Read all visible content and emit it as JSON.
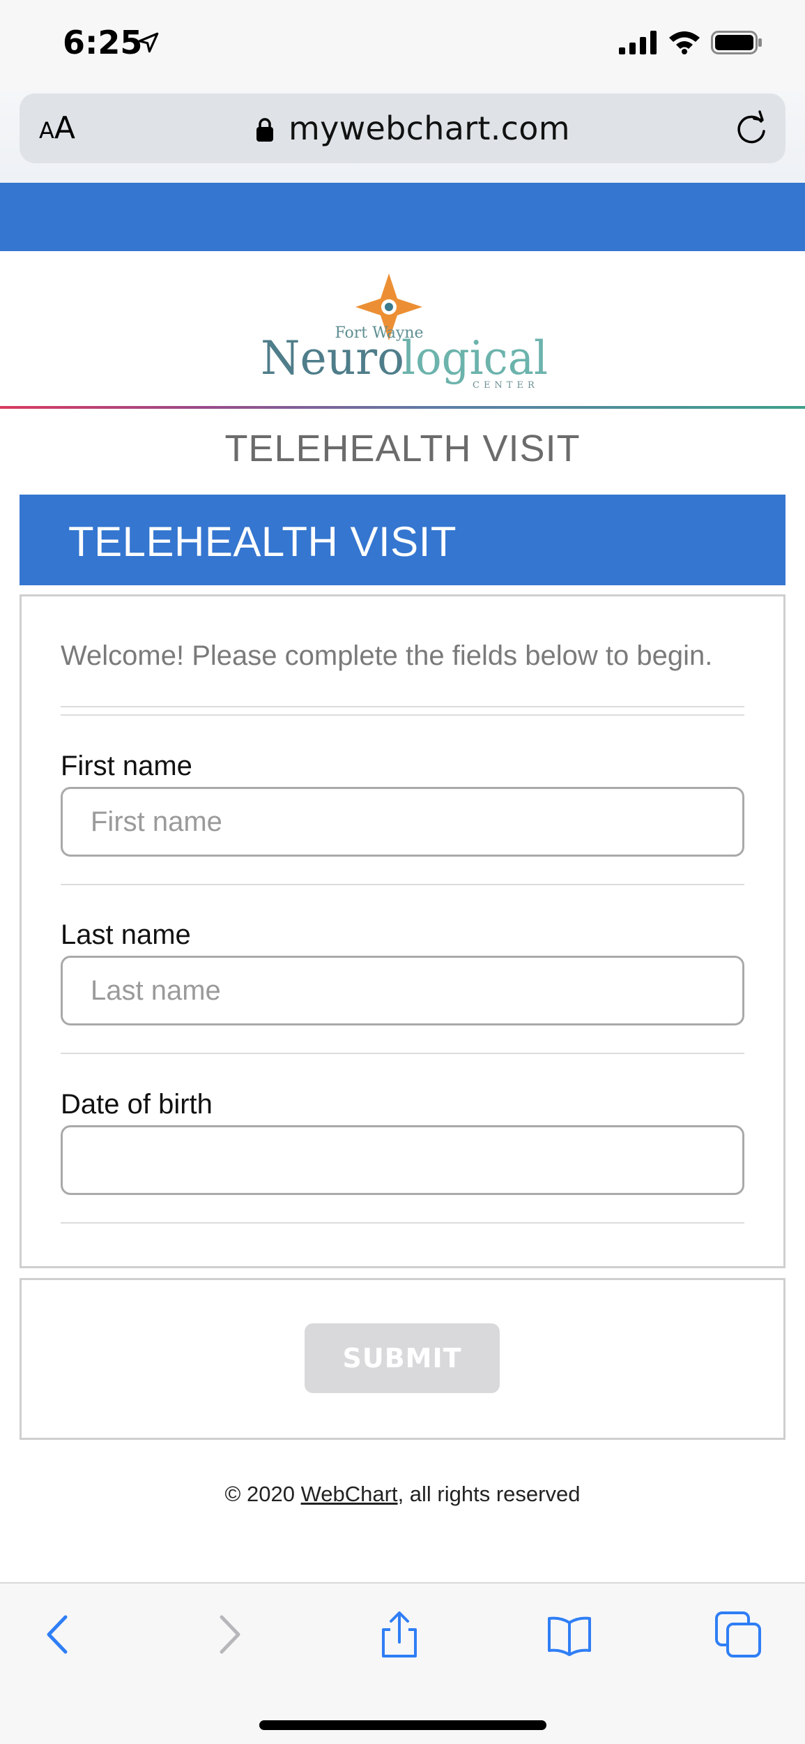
{
  "status_bar": {
    "time": "6:25"
  },
  "browser": {
    "text_size_small": "A",
    "text_size_large": "A",
    "url": "mywebchart.com"
  },
  "logo": {
    "line1": "Fort Wayne",
    "word_part1": "Neuro",
    "word_part2": "logical",
    "line3": "CENTER"
  },
  "page": {
    "heading": "TELEHEALTH VISIT",
    "section_title": "TELEHEALTH VISIT",
    "welcome": "Welcome! Please complete the fields below to begin."
  },
  "form": {
    "first_name": {
      "label": "First name",
      "placeholder": "First name",
      "value": ""
    },
    "last_name": {
      "label": "Last name",
      "placeholder": "Last name",
      "value": ""
    },
    "dob": {
      "label": "Date of birth",
      "placeholder": "",
      "value": ""
    },
    "submit_label": "SUBMIT"
  },
  "footer": {
    "prefix": "© 2020 ",
    "link": "WebChart",
    "suffix": ", all rights reserved"
  },
  "colors": {
    "brand_blue": "#3476d0",
    "logo_teal": "#5f8f92",
    "logo_orange": "#ec8f34",
    "ios_blue": "#2f7ef5"
  }
}
